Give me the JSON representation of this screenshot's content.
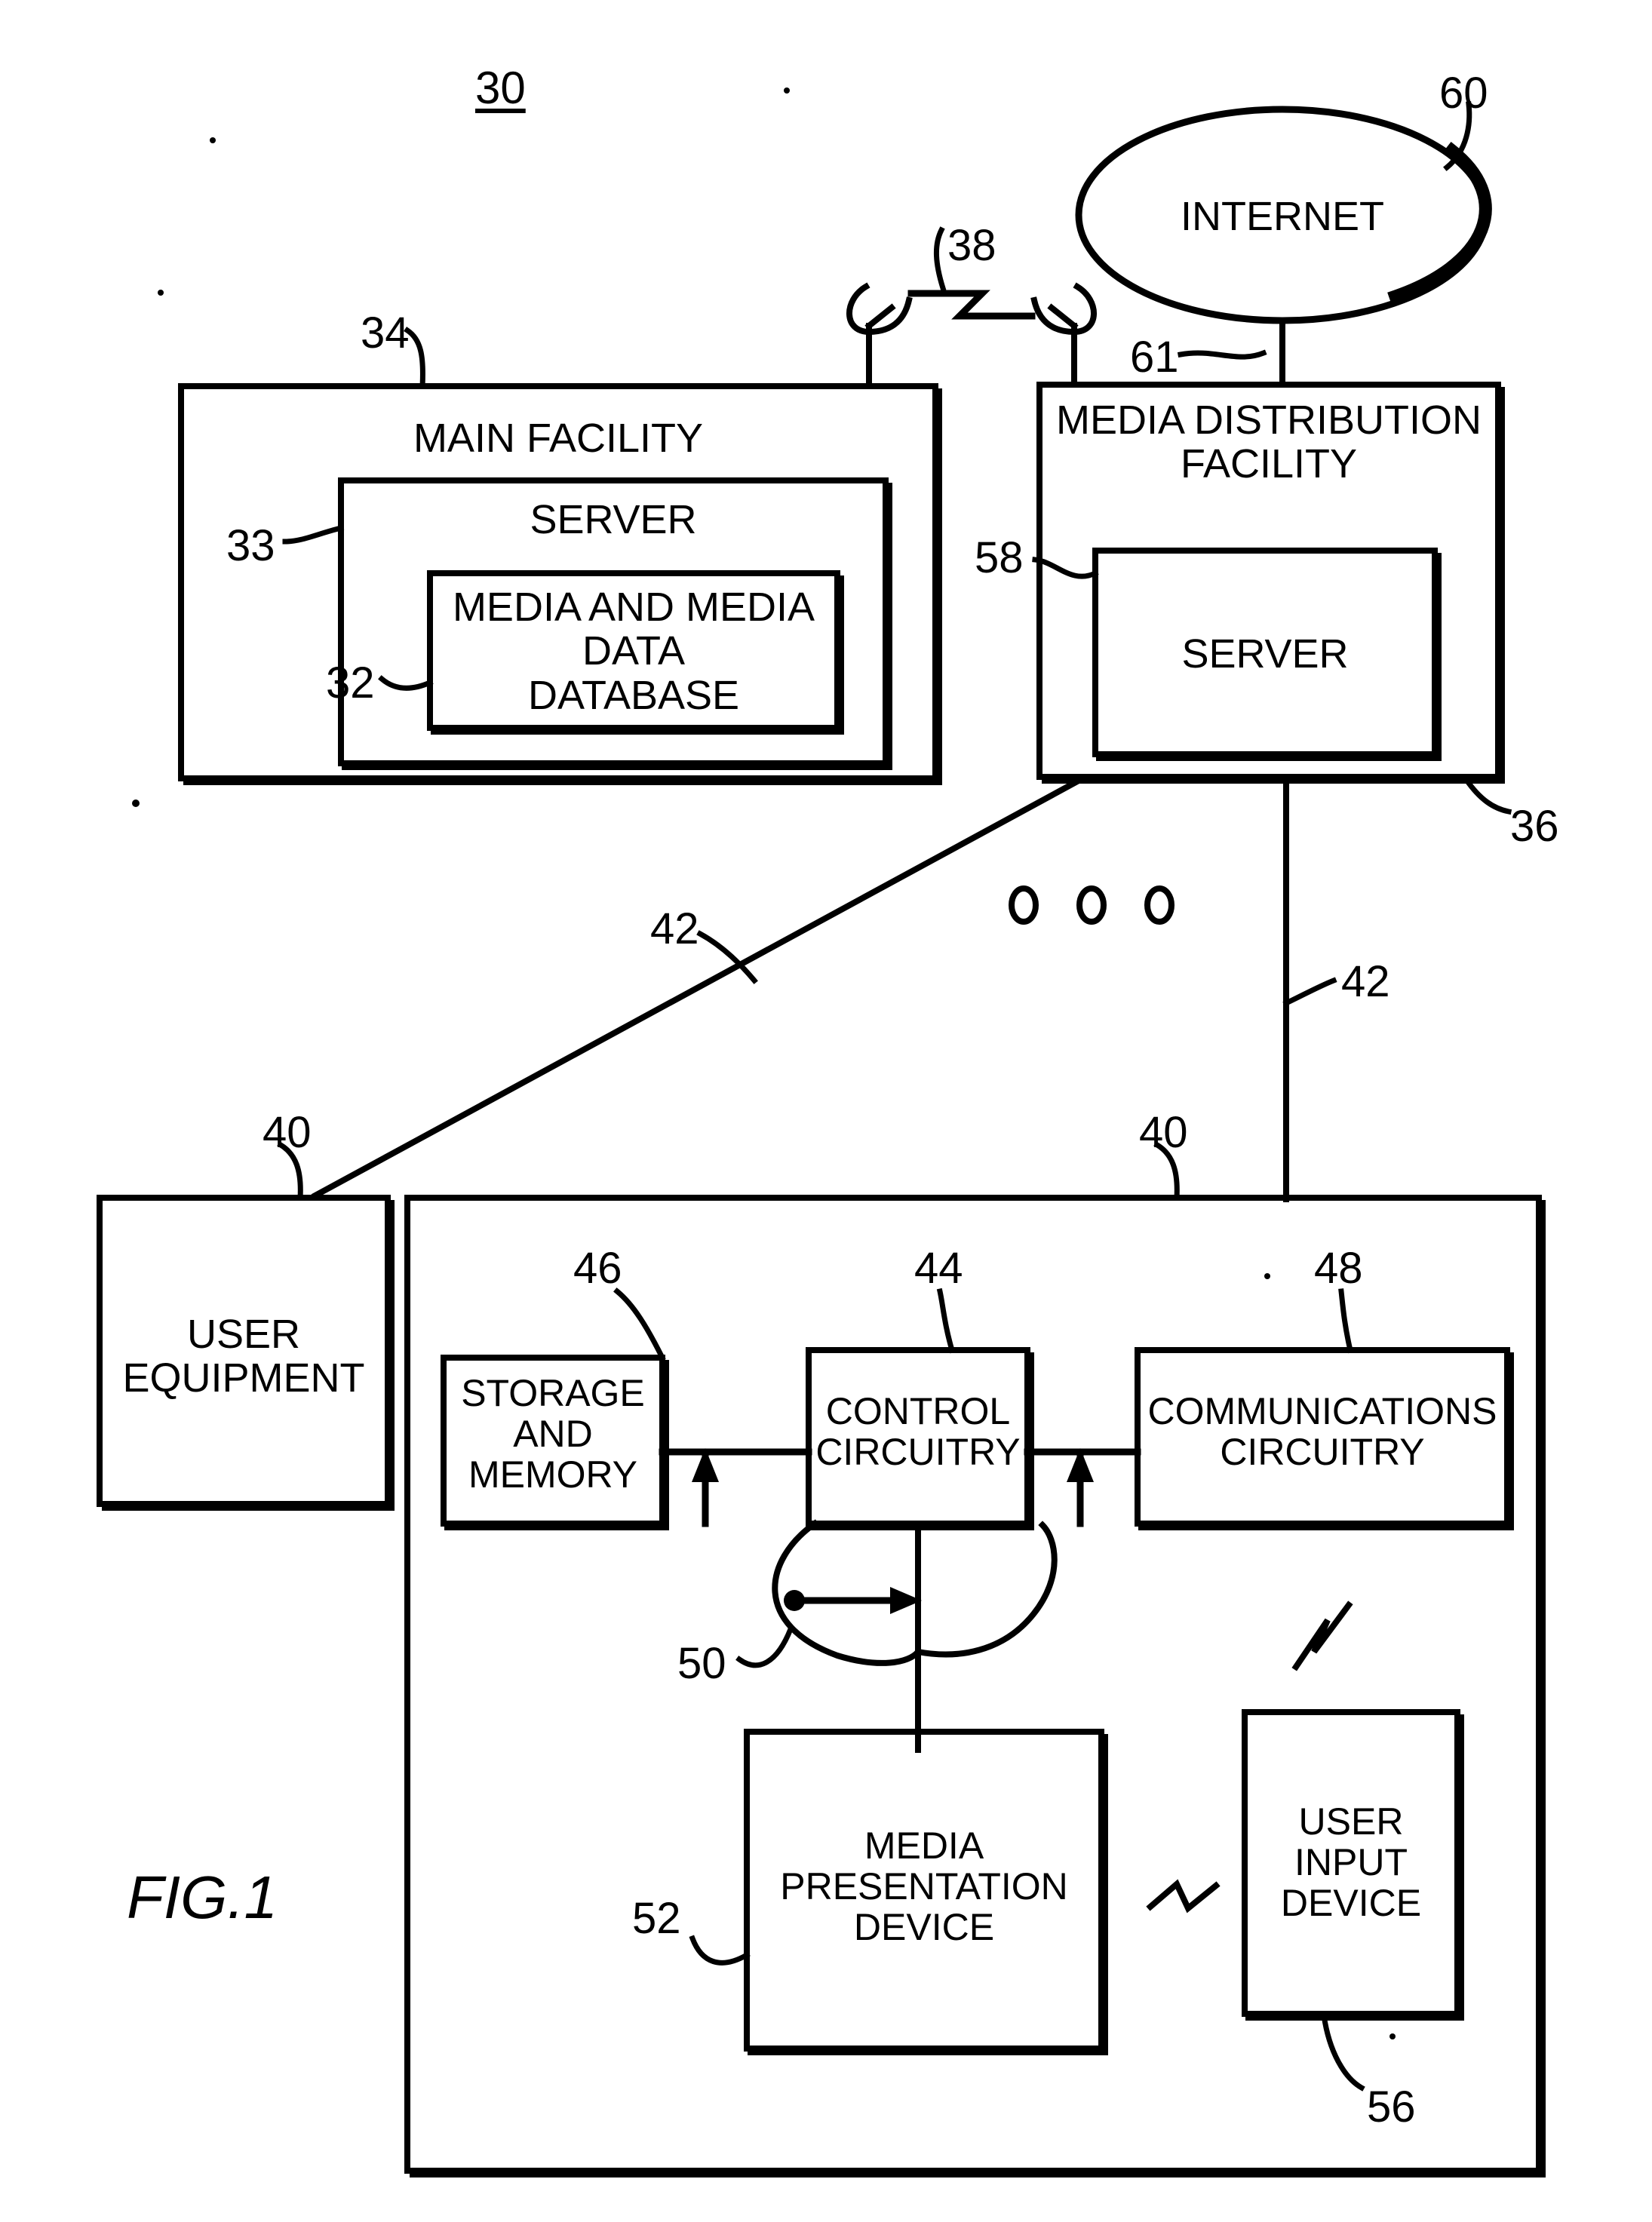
{
  "figure": {
    "caption": "FIG.1",
    "system_number": "30"
  },
  "nodes": {
    "main_facility": {
      "label": "MAIN FACILITY",
      "ref": "34"
    },
    "main_server": {
      "label": "SERVER",
      "ref": "33"
    },
    "database": {
      "label": "MEDIA AND MEDIA\nDATA\nDATABASE",
      "line1": "MEDIA AND MEDIA",
      "line2": "DATA",
      "line3": "DATABASE",
      "ref": "32"
    },
    "internet": {
      "label": "INTERNET",
      "ref": "60",
      "link_ref": "61"
    },
    "media_distribution_facility": {
      "label": "MEDIA DISTRIBUTION\nFACILITY",
      "line1": "MEDIA DISTRIBUTION",
      "line2": "FACILITY",
      "ref": "36"
    },
    "distribution_server": {
      "label": "SERVER",
      "ref": "58"
    },
    "wireless_link": {
      "ref": "38"
    },
    "user_equipment_simple": {
      "label": "USER\nEQUIPMENT",
      "line1": "USER",
      "line2": "EQUIPMENT",
      "ref": "40"
    },
    "user_equipment_detail": {
      "ref": "40"
    },
    "storage_and_memory": {
      "label": "STORAGE\nAND\nMEMORY",
      "line1": "STORAGE",
      "line2": "AND",
      "line3": "MEMORY",
      "ref": "46"
    },
    "control_circuitry": {
      "label": "CONTROL\nCIRCUITRY",
      "line1": "CONTROL",
      "line2": "CIRCUITRY",
      "ref": "44"
    },
    "communications_circuitry": {
      "label": "COMMUNICATIONS\nCIRCUITRY",
      "line1": "COMMUNICATIONS",
      "line2": "CIRCUITRY",
      "ref": "48"
    },
    "bus": {
      "ref": "50"
    },
    "media_presentation_device": {
      "label": "MEDIA\nPRESENTATION\nDEVICE",
      "line1": "MEDIA",
      "line2": "PRESENTATION",
      "line3": "DEVICE",
      "ref": "52"
    },
    "user_input_device": {
      "label": "USER\nINPUT\nDEVICE",
      "line1": "USER",
      "line2": "INPUT",
      "line3": "DEVICE",
      "ref": "56"
    },
    "comm_paths": {
      "ref_left": "42",
      "ref_right": "42"
    },
    "ellipsis": {
      "symbol": "o o o"
    }
  },
  "style": {
    "ink": "#000000",
    "paper": "#ffffff"
  }
}
